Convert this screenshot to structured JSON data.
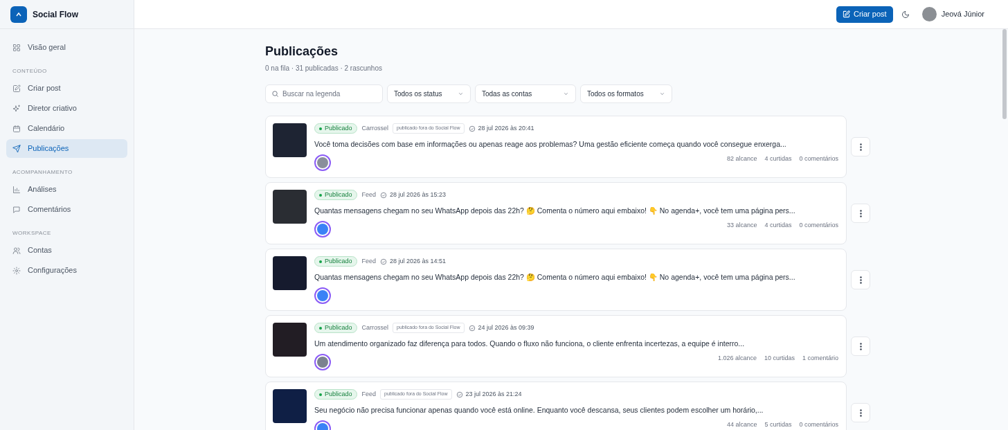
{
  "app": {
    "name": "Social Flow"
  },
  "sidebar": {
    "sections": [
      {
        "items": [
          {
            "label": "Visão geral",
            "selected": false
          }
        ]
      },
      {
        "heading": "CONTEÚDO",
        "items": [
          {
            "label": "Criar post",
            "selected": false
          },
          {
            "label": "Diretor criativo",
            "selected": false
          },
          {
            "label": "Calendário",
            "selected": false
          },
          {
            "label": "Publicações",
            "selected": true
          }
        ]
      },
      {
        "heading": "ACOMPANHAMENTO",
        "items": [
          {
            "label": "Análises",
            "selected": false
          },
          {
            "label": "Comentários",
            "selected": false
          }
        ]
      },
      {
        "heading": "WORKSPACE",
        "items": [
          {
            "label": "Contas",
            "selected": false
          },
          {
            "label": "Configurações",
            "selected": false
          }
        ]
      }
    ]
  },
  "header": {
    "create_button": "Criar post",
    "user_name": "Jeová Júnior"
  },
  "page": {
    "title": "Publicações",
    "summary": "0 na fila · 31 publicadas · 2 rascunhos"
  },
  "filters": {
    "search": {
      "placeholder": "Buscar na legenda"
    },
    "dropdowns": [
      "Todos os status",
      "Todas as contas",
      "Todos os formatos"
    ]
  },
  "posts": [
    {
      "status": "Publicado",
      "format": "Carrossel",
      "external_tag": "publicado fora do Social Flow",
      "date": "28 jul 2026 às 20:41",
      "caption": "Você toma decisões com base em informações ou apenas reage aos problemas? Uma gestão eficiente começa quando você consegue enxerga...",
      "metrics": [
        "82 alcance",
        "4 curtidas",
        "0 comentários"
      ]
    },
    {
      "status": "Publicado",
      "format": "Feed",
      "date": "28 jul 2026 às 15:23",
      "caption": "Quantas mensagens chegam no seu WhatsApp depois das 22h? 🤔 Comenta o número aqui embaixo! 👇 No agenda+, você tem uma página pers...",
      "metrics": [
        "33 alcance",
        "4 curtidas",
        "0 comentários"
      ]
    },
    {
      "status": "Publicado",
      "format": "Feed",
      "date": "28 jul 2026 às 14:51",
      "caption": "Quantas mensagens chegam no seu WhatsApp depois das 22h? 🤔 Comenta o número aqui embaixo! 👇 No agenda+, você tem uma página pers..."
    },
    {
      "status": "Publicado",
      "format": "Carrossel",
      "external_tag": "publicado fora do Social Flow",
      "date": "24 jul 2026 às 09:39",
      "caption": "Um atendimento organizado faz diferença para todos. Quando o fluxo não funciona, o cliente enfrenta incertezas, a equipe é interro...",
      "metrics": [
        "1.026 alcance",
        "10 curtidas",
        "1 comentário"
      ]
    },
    {
      "status": "Publicado",
      "format": "Feed",
      "external_tag": "publicado fora do Social Flow",
      "date": "23 jul 2026 às 21:24",
      "caption": "Seu negócio não precisa funcionar apenas quando você está online. Enquanto você descansa, seus clientes podem escolher um horário,...",
      "metrics": [
        "44 alcance",
        "5 curtidas",
        "0 comentários"
      ]
    }
  ]
}
